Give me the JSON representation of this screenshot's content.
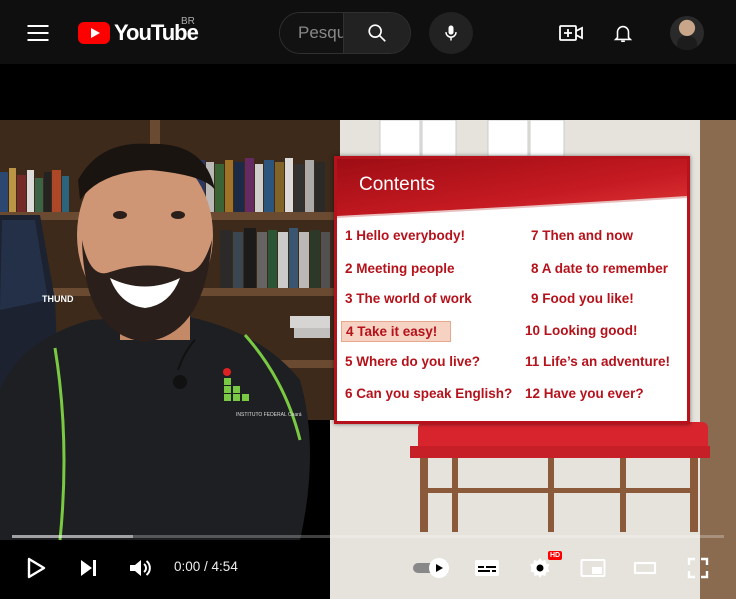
{
  "header": {
    "logo_text": "YouTube",
    "region": "BR",
    "search_placeholder": "Pesquisar"
  },
  "video": {
    "slide": {
      "title": "Contents",
      "units_left": [
        "1  Hello everybody!",
        "2  Meeting people",
        "3  The world of work",
        "4  Take it easy!",
        "5  Where do you live?",
        "6  Can you speak English?"
      ],
      "units_right": [
        "7  Then and now",
        "8  A date to remember",
        "9  Food you like!",
        "10  Looking good!",
        "11  Life’s an adventure!",
        "12  Have you ever?"
      ],
      "highlighted": "4  Take it easy!"
    },
    "chair_text": "THUND",
    "shirt_text": "INSTITUTO FEDERAL Ceará"
  },
  "player": {
    "time_current": "0:00",
    "time_separator": " / ",
    "time_total": "4:54",
    "buffered_fraction": 0.17,
    "played_fraction": 0.0,
    "quality_badge": "HD",
    "autoplay": true
  },
  "colors": {
    "brand_red": "#ff0000",
    "slide_red": "#b5121b"
  }
}
